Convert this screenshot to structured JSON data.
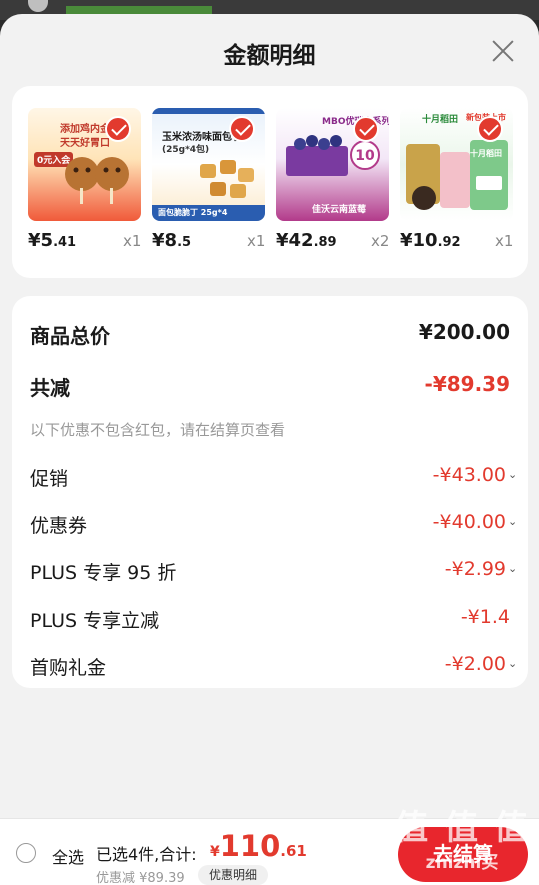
{
  "sheet": {
    "title": "金额明细"
  },
  "products": [
    {
      "price_int": "¥5",
      "price_dec": ".41",
      "qty": "x1",
      "thumb_line1": "添加鸡内金",
      "thumb_line2": "天天好胃口",
      "thumb_tag": "0元入会"
    },
    {
      "price_int": "¥8",
      "price_dec": ".5",
      "qty": "x1",
      "thumb_line1": "玉米浓汤味面包丁",
      "thumb_line2": "(25g*4包)",
      "thumb_tag": "面包脆脆丁 25g*4"
    },
    {
      "price_int": "¥42",
      "price_dec": ".89",
      "qty": "x2",
      "thumb_line1": "MBO优瑞卡系列",
      "thumb_line2": "佳沃云南蓝莓",
      "thumb_tag": "10"
    },
    {
      "price_int": "¥10",
      "price_dec": ".92",
      "qty": "x1",
      "thumb_line1": "十月稻田",
      "thumb_line2": "新包装上市",
      "thumb_tag": "十月稻田"
    }
  ],
  "summary": {
    "total_label": "商品总价",
    "total_value": "¥200.00",
    "reduce_label": "共减",
    "reduce_value": "-¥89.39",
    "note": "以下优惠不包含红包，请在结算页查看",
    "rows": [
      {
        "label": "促销",
        "value": "-¥43.00"
      },
      {
        "label": "优惠券",
        "value": "-¥40.00"
      },
      {
        "label": "PLUS 专享 95 折",
        "value": "-¥2.99"
      },
      {
        "label": "PLUS 专享立减",
        "value": "-¥1.4"
      },
      {
        "label": "首购礼金",
        "value": "-¥2.00"
      }
    ]
  },
  "bottom": {
    "select_all": "全选",
    "selected_text": "已选4件,合计:",
    "total_sym": "¥",
    "total_int": "110",
    "total_dec": ".61",
    "discount_peek": "优惠减 ¥89.39",
    "detail_peek": "优惠明细",
    "checkout": "去结算"
  },
  "watermark": {
    "line1": "值 值 值",
    "line2": "zhizhi买"
  },
  "colors": {
    "accent": "#e23a2e",
    "checkout": "#e8262d",
    "sheet_bg": "#f2f2f2"
  }
}
